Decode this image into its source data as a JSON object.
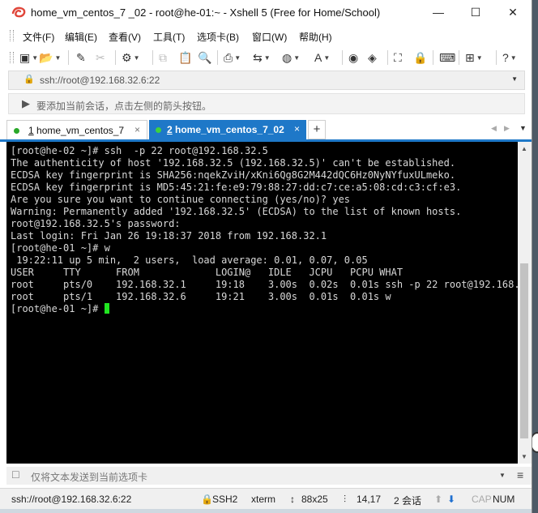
{
  "window": {
    "title": "home_vm_centos_7 _02 - root@he-01:~ - Xshell 5 (Free for Home/School)",
    "minimize": "—",
    "maximize": "☐",
    "close": "✕"
  },
  "menu": [
    "文件(F)",
    "编辑(E)",
    "查看(V)",
    "工具(T)",
    "选项卡(B)",
    "窗口(W)",
    "帮助(H)"
  ],
  "address": {
    "lock": "🔒",
    "value": "ssh://root@192.168.32.6:22",
    "dropdown": "▼"
  },
  "hint": {
    "text": "要添加当前会话，点击左侧的箭头按钮。"
  },
  "tabs": [
    {
      "index": "1",
      "label": " home_vm_centos_7",
      "close": "×"
    },
    {
      "index": "2",
      "label": " home_vm_centos_7_02",
      "close": "×"
    }
  ],
  "tab_add": "+",
  "tab_prev": "◀",
  "tab_next": "▶",
  "tab_menu": "▼",
  "terminal": {
    "lines": [
      "[root@he-02 ~]# ssh  -p 22 root@192.168.32.5",
      "The authenticity of host '192.168.32.5 (192.168.32.5)' can't be established.",
      "ECDSA key fingerprint is SHA256:nqekZviH/xKni6Qg8G2M442dQC6Hz0NyNYfuxULmeko.",
      "ECDSA key fingerprint is MD5:45:21:fe:e9:79:88:27:dd:c7:ce:a5:08:cd:c3:cf:e3.",
      "Are you sure you want to continue connecting (yes/no)? yes",
      "Warning: Permanently added '192.168.32.5' (ECDSA) to the list of known hosts.",
      "root@192.168.32.5's password:",
      "Last login: Fri Jan 26 19:18:37 2018 from 192.168.32.1",
      "[root@he-01 ~]# w",
      " 19:22:11 up 5 min,  2 users,  load average: 0.01, 0.07, 0.05",
      "USER     TTY      FROM             LOGIN@   IDLE   JCPU   PCPU WHAT",
      "root     pts/0    192.168.32.1     19:18    3.00s  0.02s  0.01s ssh -p 22 root@192.168.",
      "root     pts/1    192.168.32.6     19:21    3.00s  0.01s  0.01s w"
    ],
    "prompt": "[root@he-01 ~]# "
  },
  "compose": {
    "placeholder": "仅将文本发送到当前选项卡",
    "dropdown": "▼",
    "menu": "≡"
  },
  "status": {
    "connection": "ssh://root@192.168.32.6:22",
    "protocol": "SSH2",
    "terminal_type": "xterm",
    "size": "88x25",
    "position": "14,17",
    "sessions": "2 会话",
    "up_arrow": "⬆",
    "down_arrow": "⬇",
    "cap": "CAP",
    "num": "NUM"
  },
  "colors": {
    "tab_active": "#1e78c8",
    "terminal_bg": "#000000",
    "terminal_fg": "#d8d8d8",
    "cursor": "#21e521",
    "session_dot": "#29a829"
  }
}
